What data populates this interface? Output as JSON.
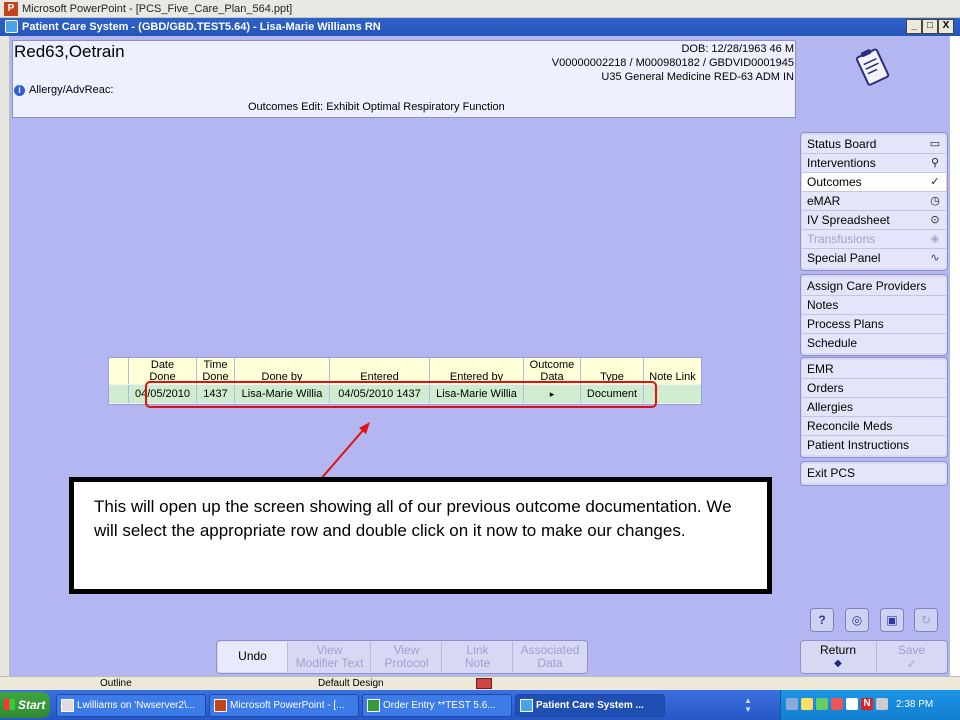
{
  "ppt_window": {
    "title": "Microsoft PowerPoint - [PCS_Five_Care_Plan_564.ppt]"
  },
  "pcs_window": {
    "title": "Patient Care System - (GBD/GBD.TEST5.64) - Lisa-Marie Williams RN",
    "controls": [
      "_",
      "□",
      "X"
    ]
  },
  "patient": {
    "name": "Red63,Oetrain",
    "dob": "DOB: 12/28/1963 46 M",
    "ids": "V00000002218 / M000980182 / GBDVID0001945",
    "location": "U35 General Medicine RED-63  ADM IN",
    "allergy_label": "Allergy/AdvReac:",
    "screen_title": "Outcomes Edit:  Exhibit Optimal Respiratory Function"
  },
  "nav": {
    "group1": [
      {
        "label": "Status Board",
        "icon": "book-icon"
      },
      {
        "label": "Interventions",
        "icon": "stethoscope-icon"
      },
      {
        "label": "Outcomes",
        "icon": "check-clipboard-icon",
        "active": true
      },
      {
        "label": "eMAR",
        "icon": "clock-med-icon"
      },
      {
        "label": "IV Spreadsheet",
        "icon": "iv-icon"
      },
      {
        "label": "Transfusions",
        "icon": "blood-icon",
        "disabled": true
      },
      {
        "label": "Special Panel",
        "icon": "pulse-icon"
      }
    ],
    "group2": [
      "Assign Care Providers",
      "Notes",
      "Process Plans",
      "Schedule"
    ],
    "group3": [
      "EMR",
      "Orders",
      "Allergies",
      "Reconcile Meds",
      "Patient Instructions"
    ],
    "group4": [
      "Exit PCS"
    ]
  },
  "icon_buttons": [
    "help-icon",
    "search-globe-icon",
    "lock-icon",
    "refresh-icon"
  ],
  "footer": {
    "return_label": "Return",
    "return_arrow": "◆",
    "save_label": "Save",
    "save_mark": "✓",
    "toolbar": [
      {
        "label": "Undo",
        "enabled": true
      },
      {
        "label": "View\nModifier Text",
        "enabled": false
      },
      {
        "label": "View\nProtocol",
        "enabled": false
      },
      {
        "label": "Link\nNote",
        "enabled": false
      },
      {
        "label": "Associated\nData",
        "enabled": false
      }
    ]
  },
  "outcomes_table": {
    "headers": [
      "Date\nDone",
      "Time\nDone",
      "Done by",
      "Entered",
      "Entered by",
      "Outcome\nData",
      "Type",
      "Note Link"
    ],
    "rows": [
      [
        "04/05/2010",
        "1437",
        "Lisa-Marie Willia",
        "04/05/2010 1437",
        "Lisa-Marie Willia",
        "▸",
        "Document",
        ""
      ]
    ]
  },
  "callout": {
    "text": "This will open up the screen showing all of our previous outcome documentation. We will select the appropriate row and double click on it now to make our changes."
  },
  "ppt_status": {
    "outline": "Outline",
    "design": "Default Design"
  },
  "taskbar": {
    "start_label": "Start",
    "items": [
      {
        "label": "Lwilliams on 'Nwserver2\\...",
        "active": false
      },
      {
        "label": "Microsoft PowerPoint - [...",
        "active": false
      },
      {
        "label": "Order Entry **TEST 5.6...",
        "active": false
      },
      {
        "label": "Patient Care System ...",
        "active": true
      }
    ],
    "clock": "2:38 PM"
  },
  "colors": {
    "pcs_background": "#b3b6f1",
    "header_panel": "#eef0ff",
    "highlight_red": "#e01010",
    "table_row_green": "#cfeccf",
    "table_header_yellow": "#ffffd8",
    "titlebar_blue": "#2455b8"
  }
}
